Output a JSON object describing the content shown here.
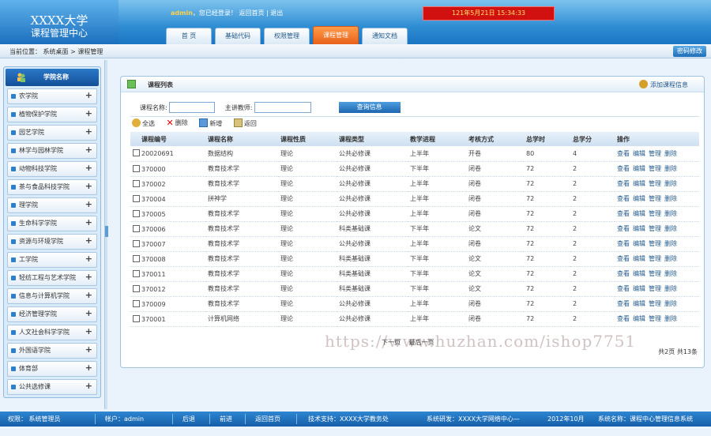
{
  "header": {
    "logo_line1": "XXXX大学",
    "logo_line2": "课程管理中心",
    "user": "admin",
    "welcome_text": "，您已经登录！",
    "home_link": "返回首页",
    "sep": "|",
    "logout_link": "退出",
    "clock": "121年5月21日  15:34:33",
    "tabs": [
      {
        "label": "首 页"
      },
      {
        "label": "基础代码"
      },
      {
        "label": "权限管理"
      },
      {
        "label": "课程管理"
      },
      {
        "label": "通知文档"
      }
    ]
  },
  "breadcrumb": {
    "text": "当前位置： 系统桌面 > 课程管理",
    "password_button": "密码修改"
  },
  "sidebar": {
    "title": "学院名称",
    "items": [
      {
        "label": "农学院"
      },
      {
        "label": "植物保护学院"
      },
      {
        "label": "园艺学院"
      },
      {
        "label": "林学与园林学院"
      },
      {
        "label": "动物科技学院"
      },
      {
        "label": "茶与食品科技学院"
      },
      {
        "label": "理学院"
      },
      {
        "label": "生命科学学院"
      },
      {
        "label": "资源与环境学院"
      },
      {
        "label": "工学院"
      },
      {
        "label": "轻纺工程与艺术学院"
      },
      {
        "label": "信息与计算机学院"
      },
      {
        "label": "经济管理学院"
      },
      {
        "label": "人文社会科学学院"
      },
      {
        "label": "外国语学院"
      },
      {
        "label": "体育部"
      },
      {
        "label": "公共选修课"
      }
    ],
    "plus": "+"
  },
  "panel": {
    "title": "课程列表",
    "add_link": "添加课程信息",
    "search": {
      "course_label": "课程名称:",
      "teacher_label": "主讲教师:",
      "query_button": "查询信息"
    },
    "toolbar": {
      "select_all": "全选",
      "delete": "删除",
      "add": "新增",
      "back": "返回"
    },
    "columns": [
      "课程编号",
      "课程名称",
      "课程性质",
      "课程类型",
      "教学进程",
      "考核方式",
      "总学时",
      "总学分",
      "操作"
    ],
    "ops": [
      "查看",
      "编辑",
      "管理",
      "删除"
    ],
    "rows": [
      [
        "20020691",
        "数据结构",
        "理论",
        "公共必修课",
        "上半年",
        "开卷",
        "80",
        "4"
      ],
      [
        "370000",
        "教育技术学",
        "理论",
        "公共必修课",
        "下半年",
        "闭卷",
        "72",
        "2"
      ],
      [
        "370002",
        "教育技术学",
        "理论",
        "公共必修课",
        "上半年",
        "闭卷",
        "72",
        "2"
      ],
      [
        "370004",
        "拼神学",
        "理论",
        "公共必修课",
        "上半年",
        "闭卷",
        "72",
        "2"
      ],
      [
        "370005",
        "教育技术学",
        "理论",
        "公共必修课",
        "上半年",
        "闭卷",
        "72",
        "2"
      ],
      [
        "370006",
        "教育技术学",
        "理论",
        "科类基础课",
        "下半年",
        "论文",
        "72",
        "2"
      ],
      [
        "370007",
        "教育技术学",
        "理论",
        "公共必修课",
        "上半年",
        "闭卷",
        "72",
        "2"
      ],
      [
        "370008",
        "教育技术学",
        "理论",
        "科类基础课",
        "下半年",
        "论文",
        "72",
        "2"
      ],
      [
        "370011",
        "教育技术学",
        "理论",
        "科类基础课",
        "下半年",
        "论文",
        "72",
        "2"
      ],
      [
        "370012",
        "教育技术学",
        "理论",
        "科类基础课",
        "下半年",
        "论文",
        "72",
        "2"
      ],
      [
        "370009",
        "教育技术学",
        "理论",
        "公共必修课",
        "上半年",
        "闭卷",
        "72",
        "2"
      ],
      [
        "370001",
        "计算机网络",
        "理论",
        "公共必修课",
        "上半年",
        "闭卷",
        "72",
        "2"
      ]
    ],
    "pager": {
      "prev": "下一页",
      "next": "最后一页"
    },
    "summary": "共2页 共13条",
    "watermark": "https://www.huzhan.com/ishop7751"
  },
  "footer": {
    "role": "权限： 系统管理员",
    "account": "帐户：admin",
    "back": "后退",
    "forward": "前进",
    "home": "返回首页",
    "support": "技术支持：XXXX大学教务处",
    "developer": "系统研发：XXXX大学网络中心—",
    "date": "2012年10月",
    "system": "系统名称：课程中心管理信息系统"
  }
}
